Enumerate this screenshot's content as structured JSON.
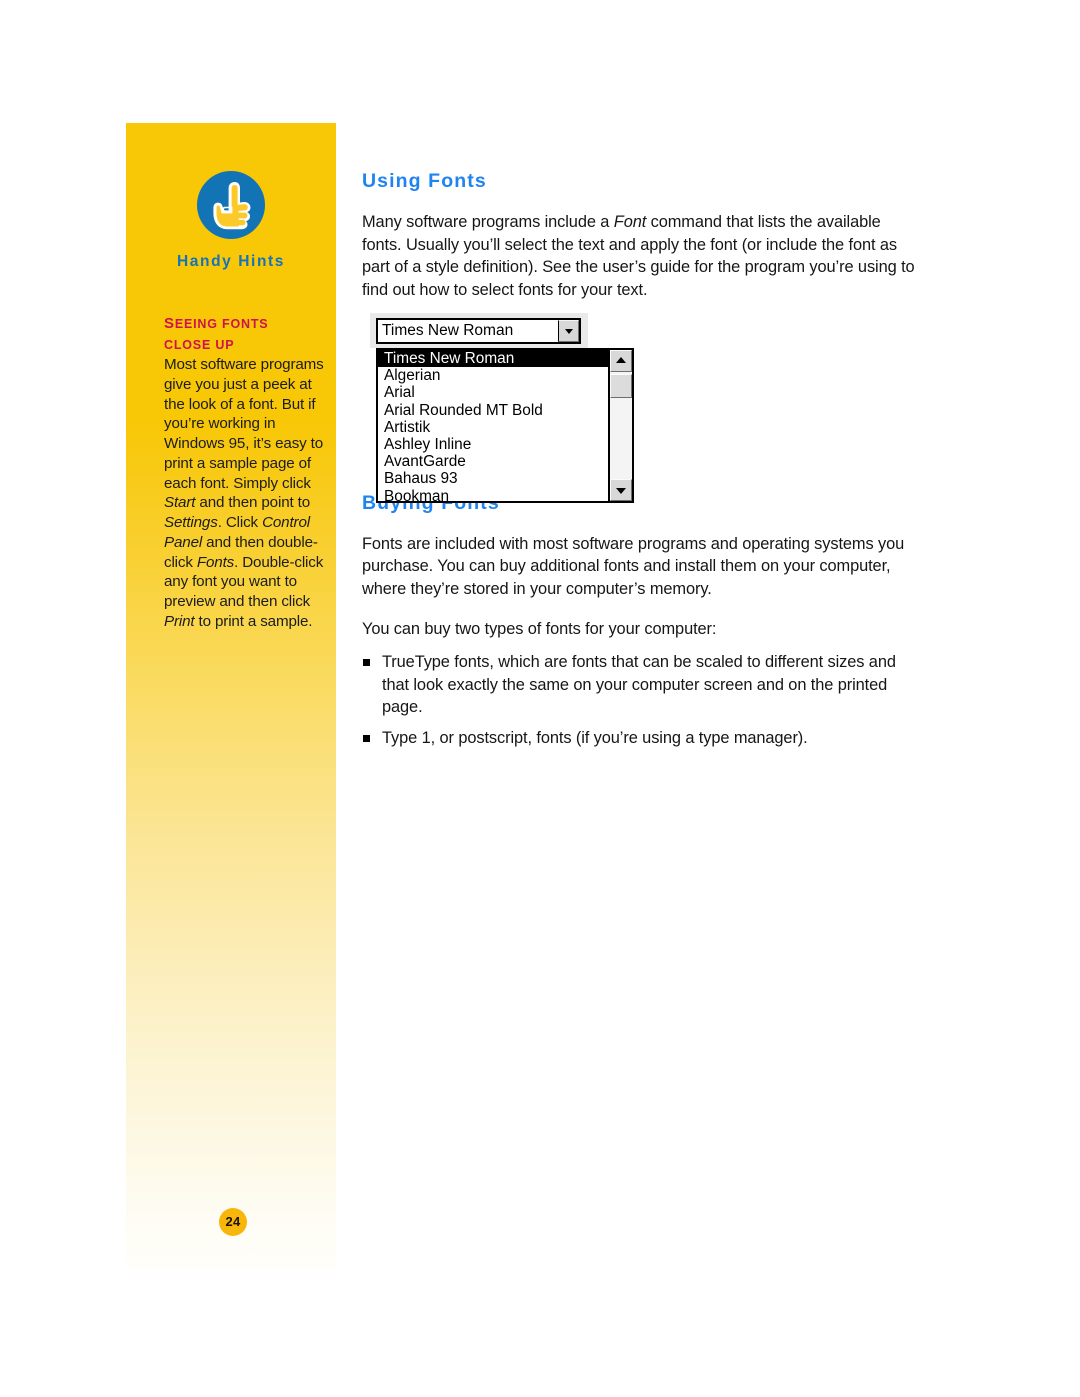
{
  "sidebar": {
    "icon_name": "pointing-hand-icon",
    "title": "Handy Hints",
    "kicker_line1": "Seeing fonts",
    "kicker_line2": "close up",
    "body_segments": [
      {
        "text": "Most software programs give you just a peek at the look of a font. But if you’re working in Windows 95, it’s easy to print a sample page of each font. Simply click ",
        "italic": false
      },
      {
        "text": "Start",
        "italic": true
      },
      {
        "text": " and then point to ",
        "italic": false
      },
      {
        "text": "Settings",
        "italic": true
      },
      {
        "text": ". Click ",
        "italic": false
      },
      {
        "text": "Control Panel",
        "italic": true
      },
      {
        "text": " and then double-click ",
        "italic": false
      },
      {
        "text": "Fonts",
        "italic": true
      },
      {
        "text": ". Double-click any font you want to preview and then click ",
        "italic": false
      },
      {
        "text": "Print",
        "italic": true
      },
      {
        "text": " to print a sample.",
        "italic": false
      }
    ],
    "page_number": "24",
    "colors": {
      "gradient_top": "#f8c706",
      "gradient_bottom": "#fffefb",
      "title": "#1473bb",
      "kicker": "#cf1150",
      "badge": "#f8b60a",
      "icon_circle": "#1273b5",
      "icon_hand": "#fbc92a"
    }
  },
  "main": {
    "heading_color": "#1f84f0",
    "sections": [
      {
        "heading": "Using Fonts",
        "paragraphs": [
          [
            {
              "text": "Many software programs include a ",
              "italic": false
            },
            {
              "text": "Font",
              "italic": true
            },
            {
              "text": " command that lists the available fonts. Usually you’ll select the text and apply the font (or include the font as part of a style definition). See the user’s guide for the program you’re using to find out how to select fonts for your text.",
              "italic": false
            }
          ]
        ]
      },
      {
        "heading": "Buying Fonts",
        "paragraphs": [
          [
            {
              "text": "Fonts are included with most software programs and operating systems you purchase. You can buy additional fonts and install them on your computer, where they’re stored in your computer’s memory.",
              "italic": false
            }
          ],
          [
            {
              "text": "You can buy two types of fonts for your computer:",
              "italic": false
            }
          ]
        ],
        "bullets": [
          "TrueType fonts, which are fonts that can be scaled to different sizes and that look exactly the same on your computer screen and on the printed page.",
          "Type 1, or postscript, fonts (if you’re using a type manager)."
        ]
      }
    ]
  },
  "font_widget": {
    "combo_value": "Times New Roman",
    "dropdown_arrow_icon": "chevron-down-icon",
    "scroll_up_icon": "scroll-up-arrow-icon",
    "scroll_down_icon": "scroll-down-arrow-icon",
    "options": [
      "Times New Roman",
      "Algerian",
      "Arial",
      "Arial Rounded MT Bold",
      "Artistik",
      "Ashley Inline",
      "AvantGarde",
      "Bahaus 93",
      "Bookman"
    ],
    "selected_index": 0
  }
}
